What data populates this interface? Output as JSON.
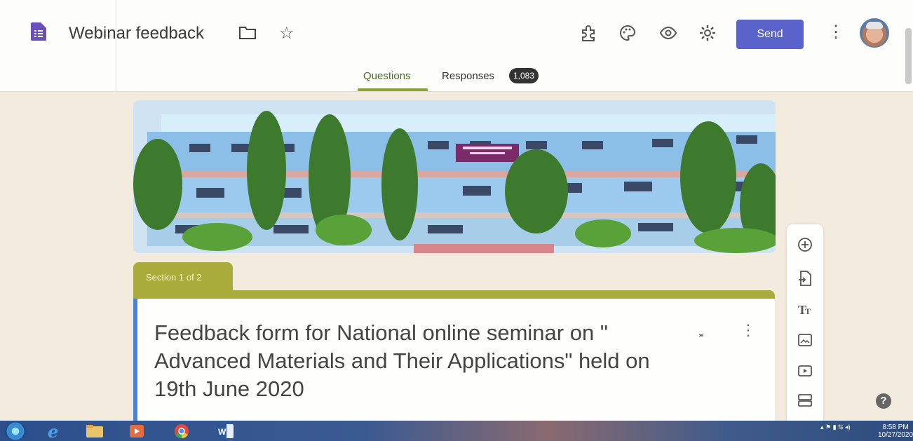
{
  "header": {
    "title": "Webinar feedback",
    "send_label": "Send",
    "tabs": [
      {
        "label": "Questions",
        "active": true
      },
      {
        "label": "Responses",
        "badge": "1,083"
      }
    ],
    "icons": [
      "addon-puzzle-icon",
      "palette-icon",
      "preview-eye-icon",
      "settings-gear-icon",
      "more-vert-icon"
    ]
  },
  "section": {
    "label": "Section 1 of 2",
    "form_title": "Feedback form for National online seminar on \" Advanced Materials and Their Applications\"   held on 19th June 2020"
  },
  "toolbar": {
    "icons": [
      "add-question-icon",
      "import-questions-icon",
      "add-title-icon",
      "add-image-icon",
      "add-video-icon",
      "add-section-icon"
    ]
  },
  "taskbar": {
    "time": "8:58 PM",
    "date": "10/27/2020"
  },
  "colors": {
    "theme": "#a9ac3b",
    "send": "#5a63c9",
    "accent": "#4a84d4",
    "background": "#f3ebdd"
  }
}
